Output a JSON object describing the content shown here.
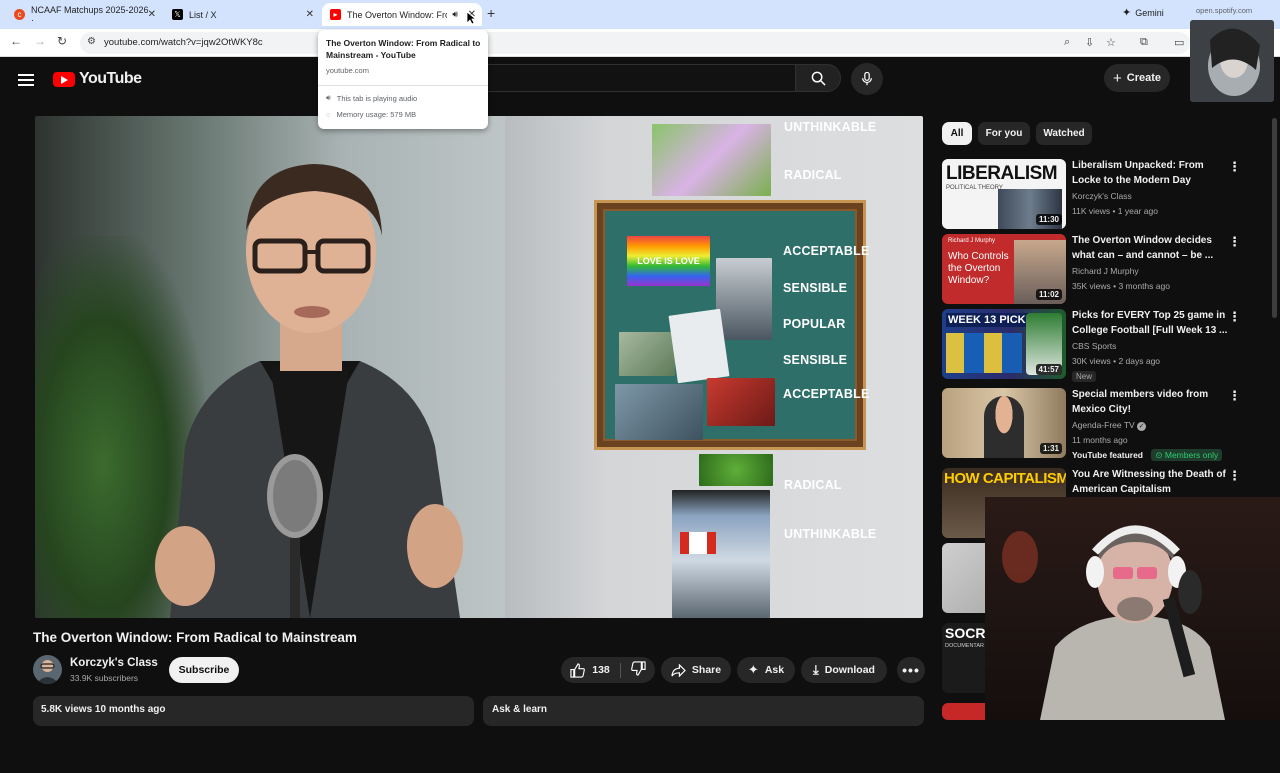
{
  "browser": {
    "tabs": [
      {
        "title": "NCAAF Matchups 2025-2026 ·",
        "favicon_color": "#e8491d"
      },
      {
        "title": "List / X",
        "favicon_color": "#000000"
      },
      {
        "title": "The Overton Window: From",
        "favicon_color": "#ff0000"
      }
    ],
    "gemini_label": "Gemini",
    "spotify_label": "open.spotify.com",
    "url": "youtube.com/watch?v=jqw2OtWKY8c",
    "tooltip": {
      "title": "The Overton Window: From Radical to Mainstream - YouTube",
      "domain": "youtube.com",
      "audio": "This tab is playing audio",
      "memory": "Memory usage: 579 MB"
    }
  },
  "youtube": {
    "logo": "YouTube",
    "create_label": "Create",
    "video": {
      "labels": [
        "UNTHINKABLE",
        "RADICAL",
        "ACCEPTABLE",
        "SENSIBLE",
        "POPULAR",
        "SENSIBLE",
        "ACCEPTABLE",
        "RADICAL",
        "UNTHINKABLE"
      ],
      "sign_text": "LOVE IS LOVE"
    },
    "title": "The Overton Window: From Radical to Mainstream",
    "channel": {
      "name": "Korczyk's Class",
      "subscribers": "33.9K subscribers"
    },
    "subscribe_label": "Subscribe",
    "likes": "138",
    "share_label": "Share",
    "ask_label": "Ask",
    "download_label": "Download",
    "description_meta": "5.8K views  10 months ago",
    "ask_learn_label": "Ask & learn",
    "chips": [
      "All",
      "For you",
      "Watched"
    ],
    "recommendations": [
      {
        "title": "Liberalism Unpacked: From Locke to the Modern Day",
        "channel": "Korczyk's Class",
        "meta": "11K views • 1 year ago",
        "duration": "11:30",
        "thumb_text": "LIBERALISM",
        "thumb_sub": "POLITICAL THEORY"
      },
      {
        "title": "The Overton Window decides what can – and cannot – be ...",
        "channel": "Richard J Murphy",
        "meta": "35K views • 3 months ago",
        "duration": "11:02",
        "thumb_text": "Who Controls the Overton Window?",
        "thumb_sub": "Richard J Murphy"
      },
      {
        "title": "Picks for EVERY Top 25 game in College Football [Full Week 13 ...",
        "channel": "CBS Sports",
        "meta": "30K views • 2 days ago",
        "duration": "41:57",
        "badge": "New",
        "thumb_text": "WEEK 13 PICKS"
      },
      {
        "title": "Special members video from Mexico City!",
        "channel": "Agenda-Free TV",
        "meta": "11 months ago",
        "duration": "1:31",
        "badge": "YouTube featured",
        "members": "Members only"
      },
      {
        "title": "You Are Witnessing the Death of American Capitalism",
        "thumb_text": "HOW CAPITALISM"
      }
    ],
    "partial_thumb_text": "SOCR",
    "partial_thumb_sub": "DOCUMENTAR"
  }
}
